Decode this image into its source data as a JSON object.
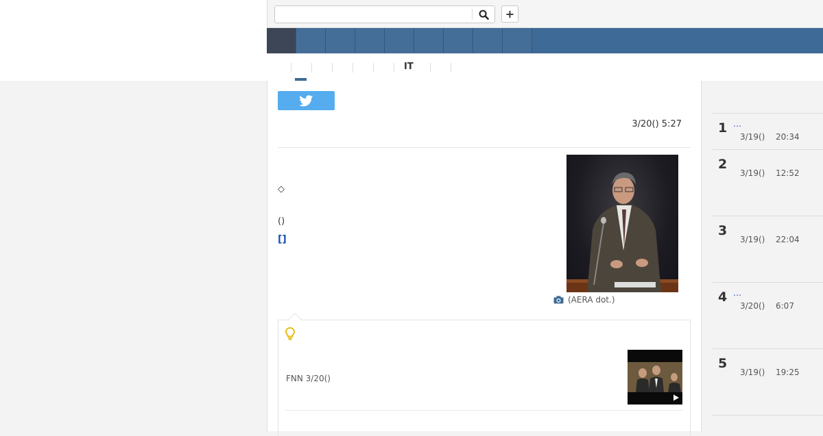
{
  "search": {
    "placeholder": "",
    "value": ""
  },
  "header": {
    "plus_label": "+"
  },
  "nav": {
    "items": [
      "",
      "",
      "",
      "",
      "",
      "",
      "",
      "",
      ""
    ]
  },
  "subnav": {
    "items": [
      "",
      "",
      "",
      "",
      "",
      "IT",
      ""
    ]
  },
  "article": {
    "date": "3/20() 5:27",
    "diamond": "◇",
    "paren": "()",
    "link": "[]",
    "photo_caption": "(AERA dot.)"
  },
  "related": {
    "source": "FNN 3/20()"
  },
  "ranking": {
    "items": [
      {
        "num": "1",
        "title": "…",
        "date": "3/19()",
        "time": "20:34"
      },
      {
        "num": "2",
        "title": "",
        "date": "3/19()",
        "time": "12:52"
      },
      {
        "num": "3",
        "title": "",
        "date": "3/19()",
        "time": "22:04"
      },
      {
        "num": "4",
        "title": "…",
        "date": "3/20()",
        "time": "6:07"
      },
      {
        "num": "5",
        "title": "",
        "date": "3/19()",
        "time": "19:25"
      }
    ]
  },
  "colors": {
    "nav_bg": "#3d6a96",
    "twitter": "#55acee",
    "link": "#1450b4",
    "bulb": "#e6b800"
  },
  "icons": {
    "search": "search-icon",
    "twitter": "twitter-icon",
    "camera": "camera-icon",
    "bulb": "lightbulb-icon",
    "play": "play-icon"
  }
}
